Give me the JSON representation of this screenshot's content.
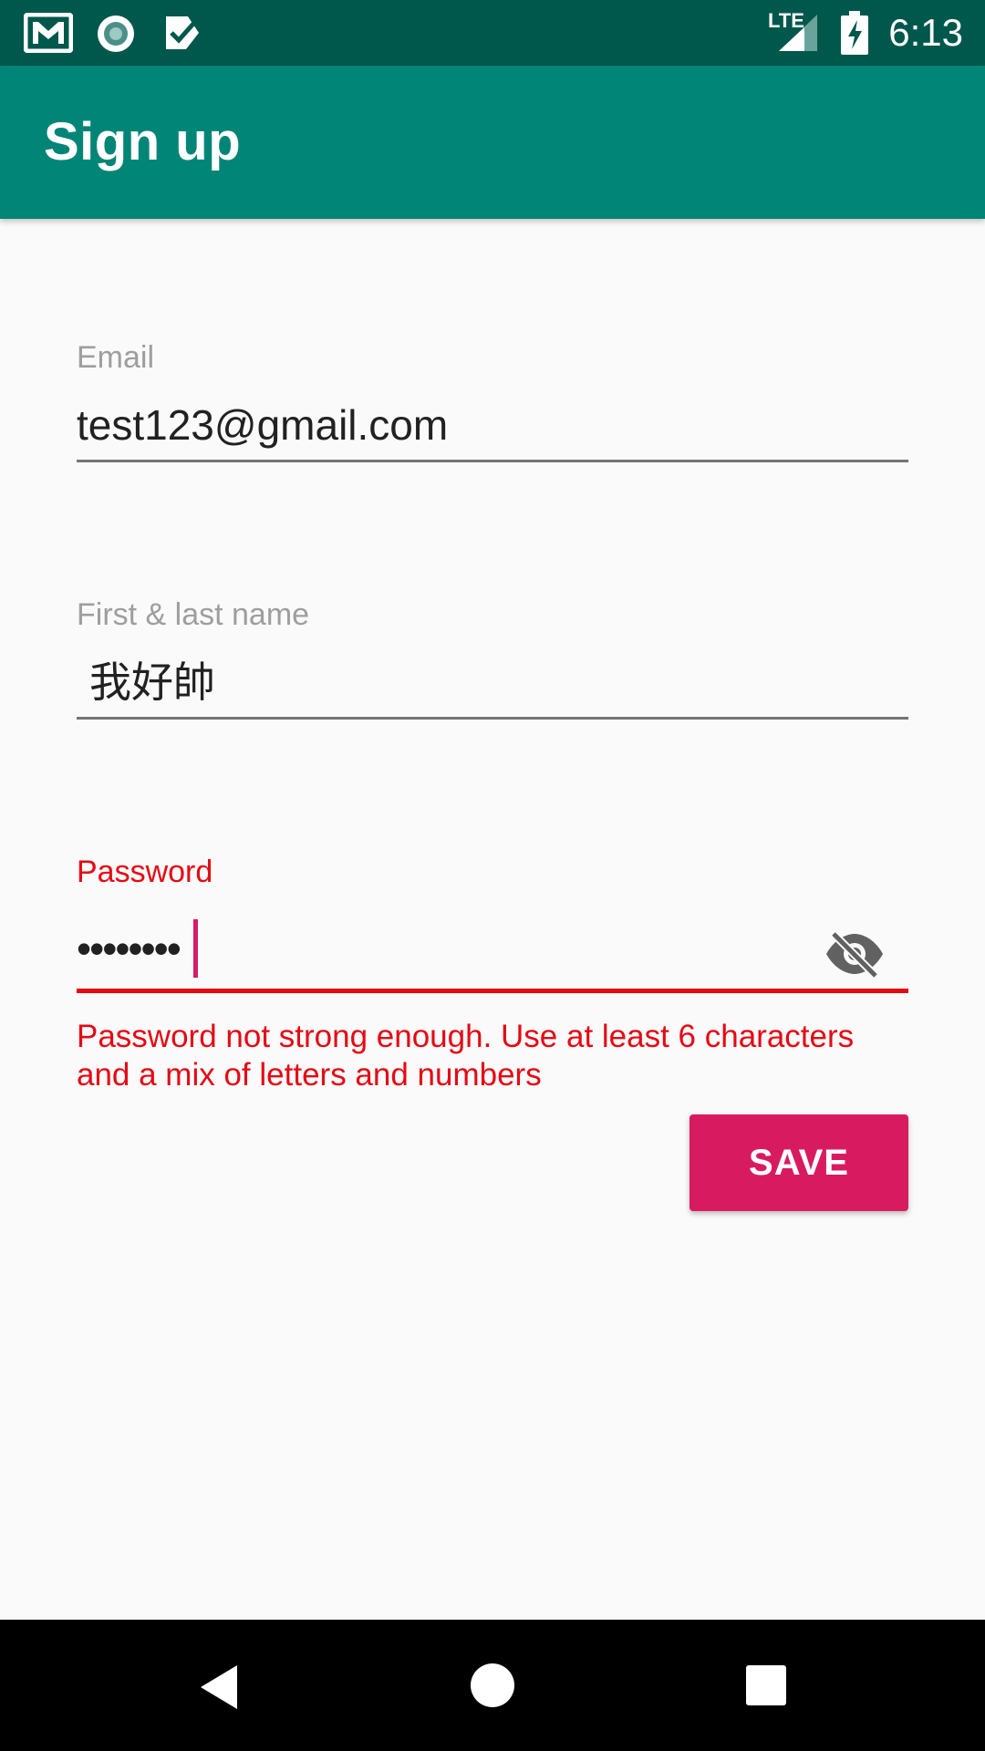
{
  "status_bar": {
    "time": "6:13",
    "network_label": "LTE",
    "left_icons": [
      "gmail-icon",
      "record-icon",
      "task-icon"
    ],
    "right_icons": [
      "lte-signal-icon",
      "battery-charging-icon"
    ]
  },
  "app_bar": {
    "title": "Sign up",
    "color": "#008577"
  },
  "form": {
    "email": {
      "label": "Email",
      "value": "test123@gmail.com"
    },
    "name": {
      "label": "First & last name",
      "value": "我好帥"
    },
    "password": {
      "label": "Password",
      "masked_value": "••••••••",
      "visibility_icon": "eye-off-icon",
      "error": "Password not strong enough. Use at least 6 characters and a mix of letters and numbers"
    },
    "save_label": "SAVE"
  },
  "colors": {
    "accent": "#d81b60",
    "error": "#e50914",
    "primary_dark": "#00574b"
  },
  "nav_bar": {
    "icons": [
      "back-icon",
      "home-icon",
      "recents-icon"
    ]
  }
}
